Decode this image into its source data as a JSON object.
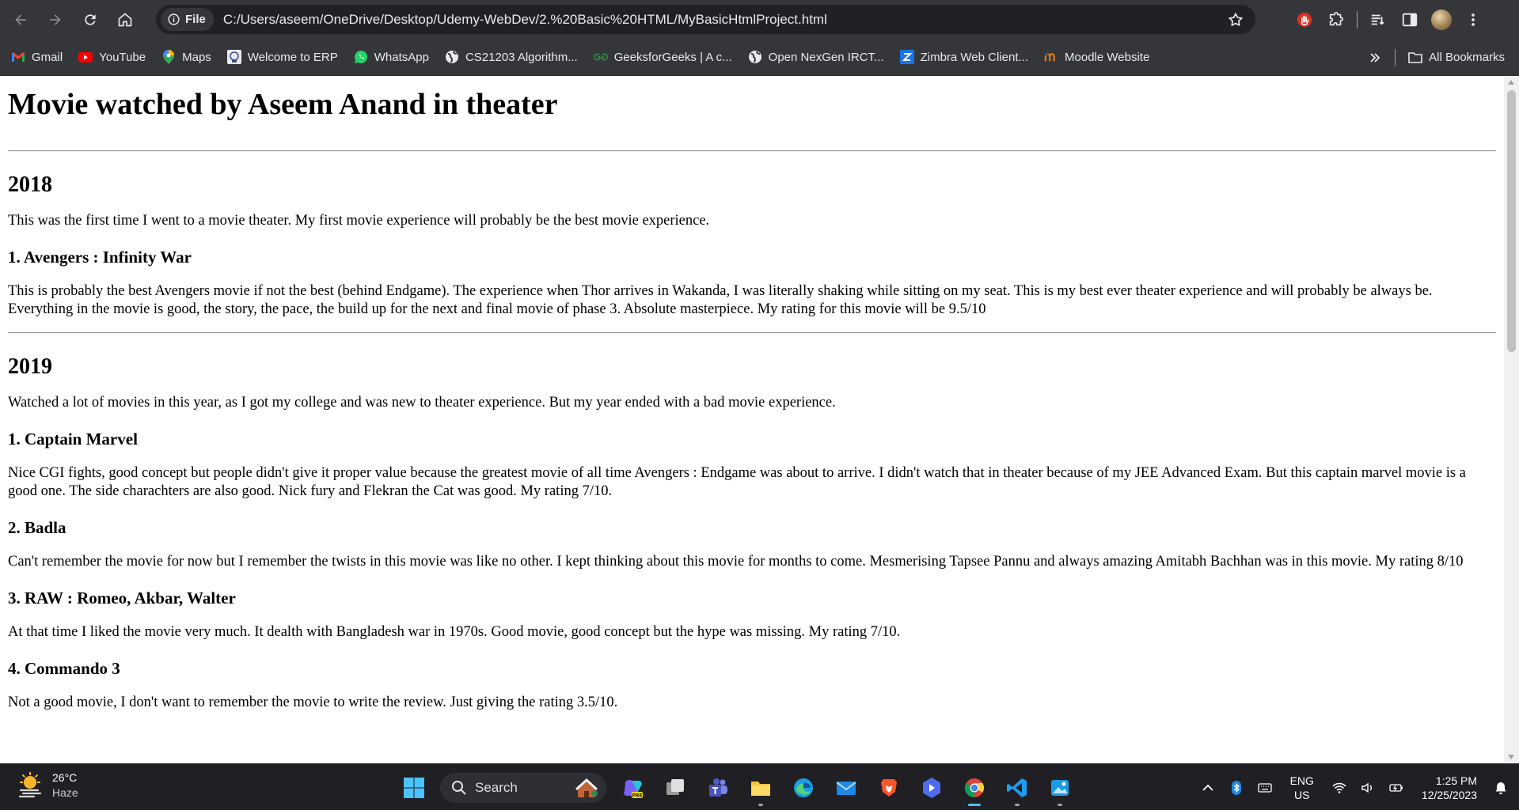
{
  "browser": {
    "site_chip_label": "File",
    "url": "C:/Users/aseem/OneDrive/Desktop/Udemy-WebDev/2.%20Basic%20HTML/MyBasicHtmlProject.html"
  },
  "bookmarks": [
    {
      "label": "Gmail",
      "icon": "gmail-icon"
    },
    {
      "label": "YouTube",
      "icon": "youtube-icon"
    },
    {
      "label": "Maps",
      "icon": "maps-icon"
    },
    {
      "label": "Welcome to ERP",
      "icon": "erp-icon"
    },
    {
      "label": "WhatsApp",
      "icon": "whatsapp-icon"
    },
    {
      "label": "CS21203 Algorithm...",
      "icon": "globe-icon"
    },
    {
      "label": "GeeksforGeeks | A c...",
      "icon": "geeksforgeeks-icon"
    },
    {
      "label": "Open NexGen IRCT...",
      "icon": "globe-icon"
    },
    {
      "label": "Zimbra Web Client...",
      "icon": "zimbra-icon"
    },
    {
      "label": "Moodle Website",
      "icon": "moodle-icon"
    }
  ],
  "all_bookmarks_label": "All Bookmarks",
  "page": {
    "title": "Movie watched by Aseem Anand in theater",
    "sections": [
      {
        "year": "2018",
        "intro": "This was the first time I went to a movie theater. My first movie experience will probably be the best movie experience.",
        "movies": [
          {
            "heading": "1. Avengers : Infinity War",
            "review": "This is probably the best Avengers movie if not the best (behind Endgame). The experience when Thor arrives in Wakanda, I was literally shaking while sitting on my seat. This is my best ever theater experience and will probably be always be. Everything in the movie is good, the story, the pace, the build up for the next and final movie of phase 3. Absolute masterpiece. My rating for this movie will be 9.5/10"
          }
        ]
      },
      {
        "year": "2019",
        "intro": "Watched a lot of movies in this year, as I got my college and was new to theater experience. But my year ended with a bad movie experience.",
        "movies": [
          {
            "heading": "1. Captain Marvel",
            "review": "Nice CGI fights, good concept but people didn't give it proper value because the greatest movie of all time Avengers : Endgame was about to arrive. I didn't watch that in theater because of my JEE Advanced Exam. But this captain marvel movie is a good one. The side charachters are also good. Nick fury and Flekran the Cat was good. My rating 7/10."
          },
          {
            "heading": "2. Badla",
            "review": "Can't remember the movie for now but I remember the twists in this movie was like no other. I kept thinking about this movie for months to come. Mesmerising Tapsee Pannu and always amazing Amitabh Bachhan was in this movie. My rating 8/10"
          },
          {
            "heading": "3. RAW : Romeo, Akbar, Walter",
            "review": "At that time I liked the movie very much. It dealth with Bangladesh war in 1970s. Good movie, good concept but the hype was missing. My rating 7/10."
          },
          {
            "heading": "4. Commando 3",
            "review": "Not a good movie, I don't want to remember the movie to write the review. Just giving the rating 3.5/10."
          }
        ]
      }
    ]
  },
  "taskbar": {
    "temperature": "26°C",
    "condition": "Haze",
    "search_placeholder": "Search",
    "language_line1": "ENG",
    "language_line2": "US",
    "time": "1:25 PM",
    "date": "12/25/2023"
  }
}
